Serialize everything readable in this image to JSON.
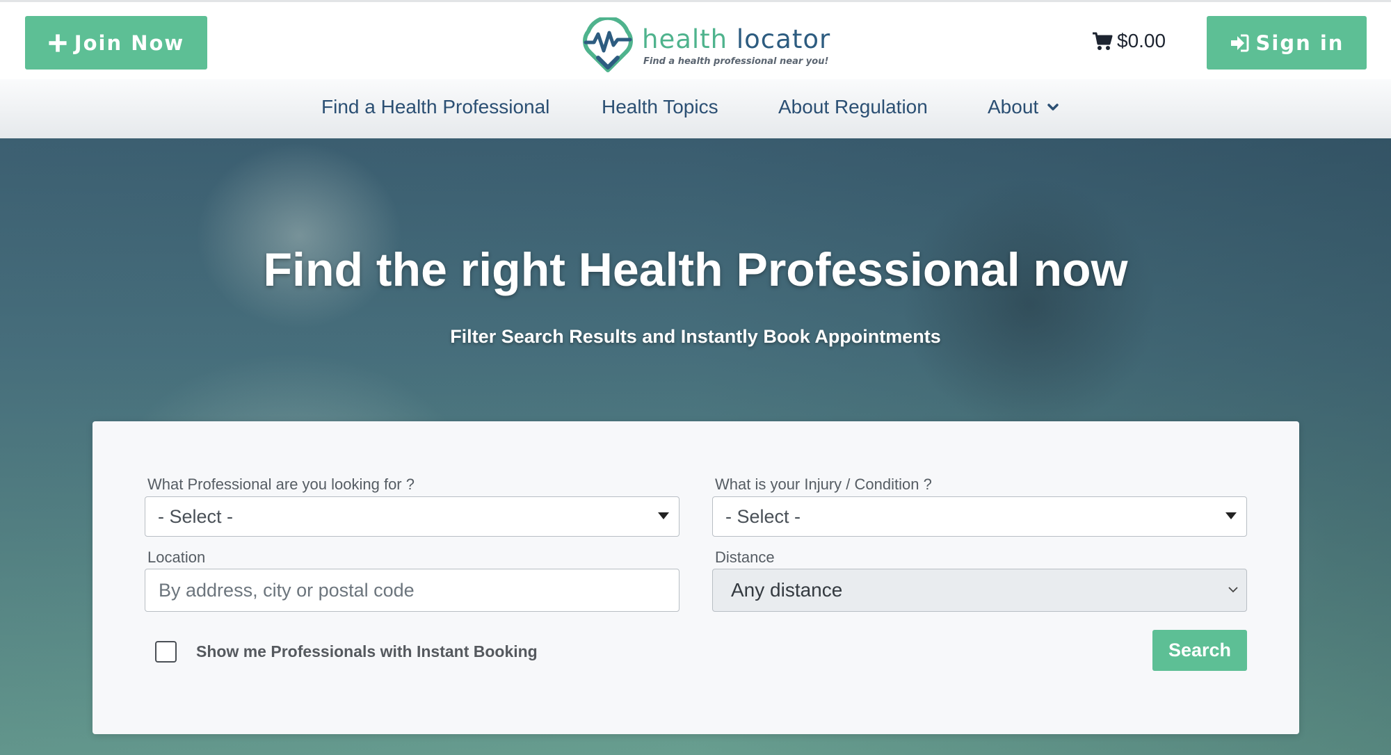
{
  "header": {
    "join_label": "Join Now",
    "signin_label": "Sign in",
    "logo": {
      "word1": "health",
      "word2": "locator",
      "tagline": "Find a health professional near you!"
    },
    "cart_total": "$0.00"
  },
  "nav": {
    "items": [
      {
        "label": "Find a Health Professional"
      },
      {
        "label": "Health Topics"
      },
      {
        "label": "About Regulation"
      },
      {
        "label": "About",
        "has_dropdown": true
      }
    ]
  },
  "hero": {
    "title": "Find the right Health Professional now",
    "subtitle": "Filter Search Results and Instantly Book Appointments"
  },
  "search": {
    "professional_label": "What Professional are you looking for ?",
    "professional_value": "- Select -",
    "condition_label": "What is your Injury / Condition ?",
    "condition_value": "- Select -",
    "location_label": "Location",
    "location_placeholder": "By address, city or postal code",
    "distance_label": "Distance",
    "distance_value": "Any distance",
    "instant_booking_label": "Show me Professionals with Instant Booking",
    "instant_booking_checked": false,
    "search_button": "Search"
  },
  "colors": {
    "brand_green": "#5dbf95",
    "brand_navy": "#2d5c80",
    "nav_text": "#2b4f73"
  },
  "icons": {
    "join": "plus-icon",
    "signin": "sign-in-icon",
    "cart": "shopping-cart-icon",
    "about_dropdown": "chevron-down-icon",
    "select_caret": "caret-down-icon"
  }
}
